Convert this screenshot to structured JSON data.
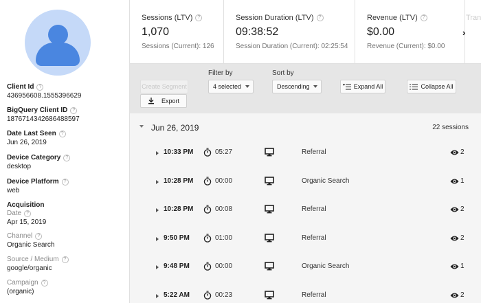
{
  "client": {
    "fields": [
      {
        "label": "Client Id",
        "value": "436956608.1555396629"
      },
      {
        "label": "BigQuery Client ID",
        "value": "1876714342686488597"
      },
      {
        "label": "Date Last Seen",
        "value": "Jun 26, 2019"
      },
      {
        "label": "Device Category",
        "value": "desktop"
      },
      {
        "label": "Device Platform",
        "value": "web"
      }
    ],
    "acquisition": {
      "title": "Acquisition",
      "items": [
        {
          "label": "Date",
          "value": "Apr 15, 2019"
        },
        {
          "label": "Channel",
          "value": "Organic Search"
        },
        {
          "label": "Source / Medium",
          "value": "google/organic"
        },
        {
          "label": "Campaign",
          "value": "(organic)"
        }
      ]
    }
  },
  "metrics": [
    {
      "title": "Sessions (LTV)",
      "value": "1,070",
      "sub": "Sessions (Current): 126"
    },
    {
      "title": "Session Duration (LTV)",
      "value": "09:38:52",
      "sub": "Session Duration (Current): 02:25:54"
    },
    {
      "title": "Revenue (LTV)",
      "value": "$0.00",
      "sub": "Revenue (Current): $0.00"
    }
  ],
  "metrics_overflow_label": "Trans",
  "toolbar": {
    "create_segment": "Create Segment",
    "export": "Export",
    "filter_label": "Filter by",
    "filter_value": "4 selected",
    "sort_label": "Sort by",
    "sort_value": "Descending",
    "expand_all": "Expand All",
    "collapse_all": "Collapse All"
  },
  "day": {
    "date": "Jun 26, 2019",
    "count": "22 sessions"
  },
  "sessions": [
    {
      "time": "10:33 PM",
      "duration": "05:27",
      "channel": "Referral",
      "views": "2"
    },
    {
      "time": "10:28 PM",
      "duration": "00:00",
      "channel": "Organic Search",
      "views": "1"
    },
    {
      "time": "10:28 PM",
      "duration": "00:08",
      "channel": "Referral",
      "views": "2"
    },
    {
      "time": "9:50 PM",
      "duration": "01:00",
      "channel": "Referral",
      "views": "2"
    },
    {
      "time": "9:48 PM",
      "duration": "00:00",
      "channel": "Organic Search",
      "views": "1"
    },
    {
      "time": "5:22 AM",
      "duration": "00:23",
      "channel": "Referral",
      "views": "2"
    }
  ],
  "colors": {
    "avatar_bg": "#c5d9f8",
    "avatar_fg": "#4a86e0",
    "toolbar_bg": "#e6e6e6",
    "list_bg": "#f5f5f5"
  }
}
